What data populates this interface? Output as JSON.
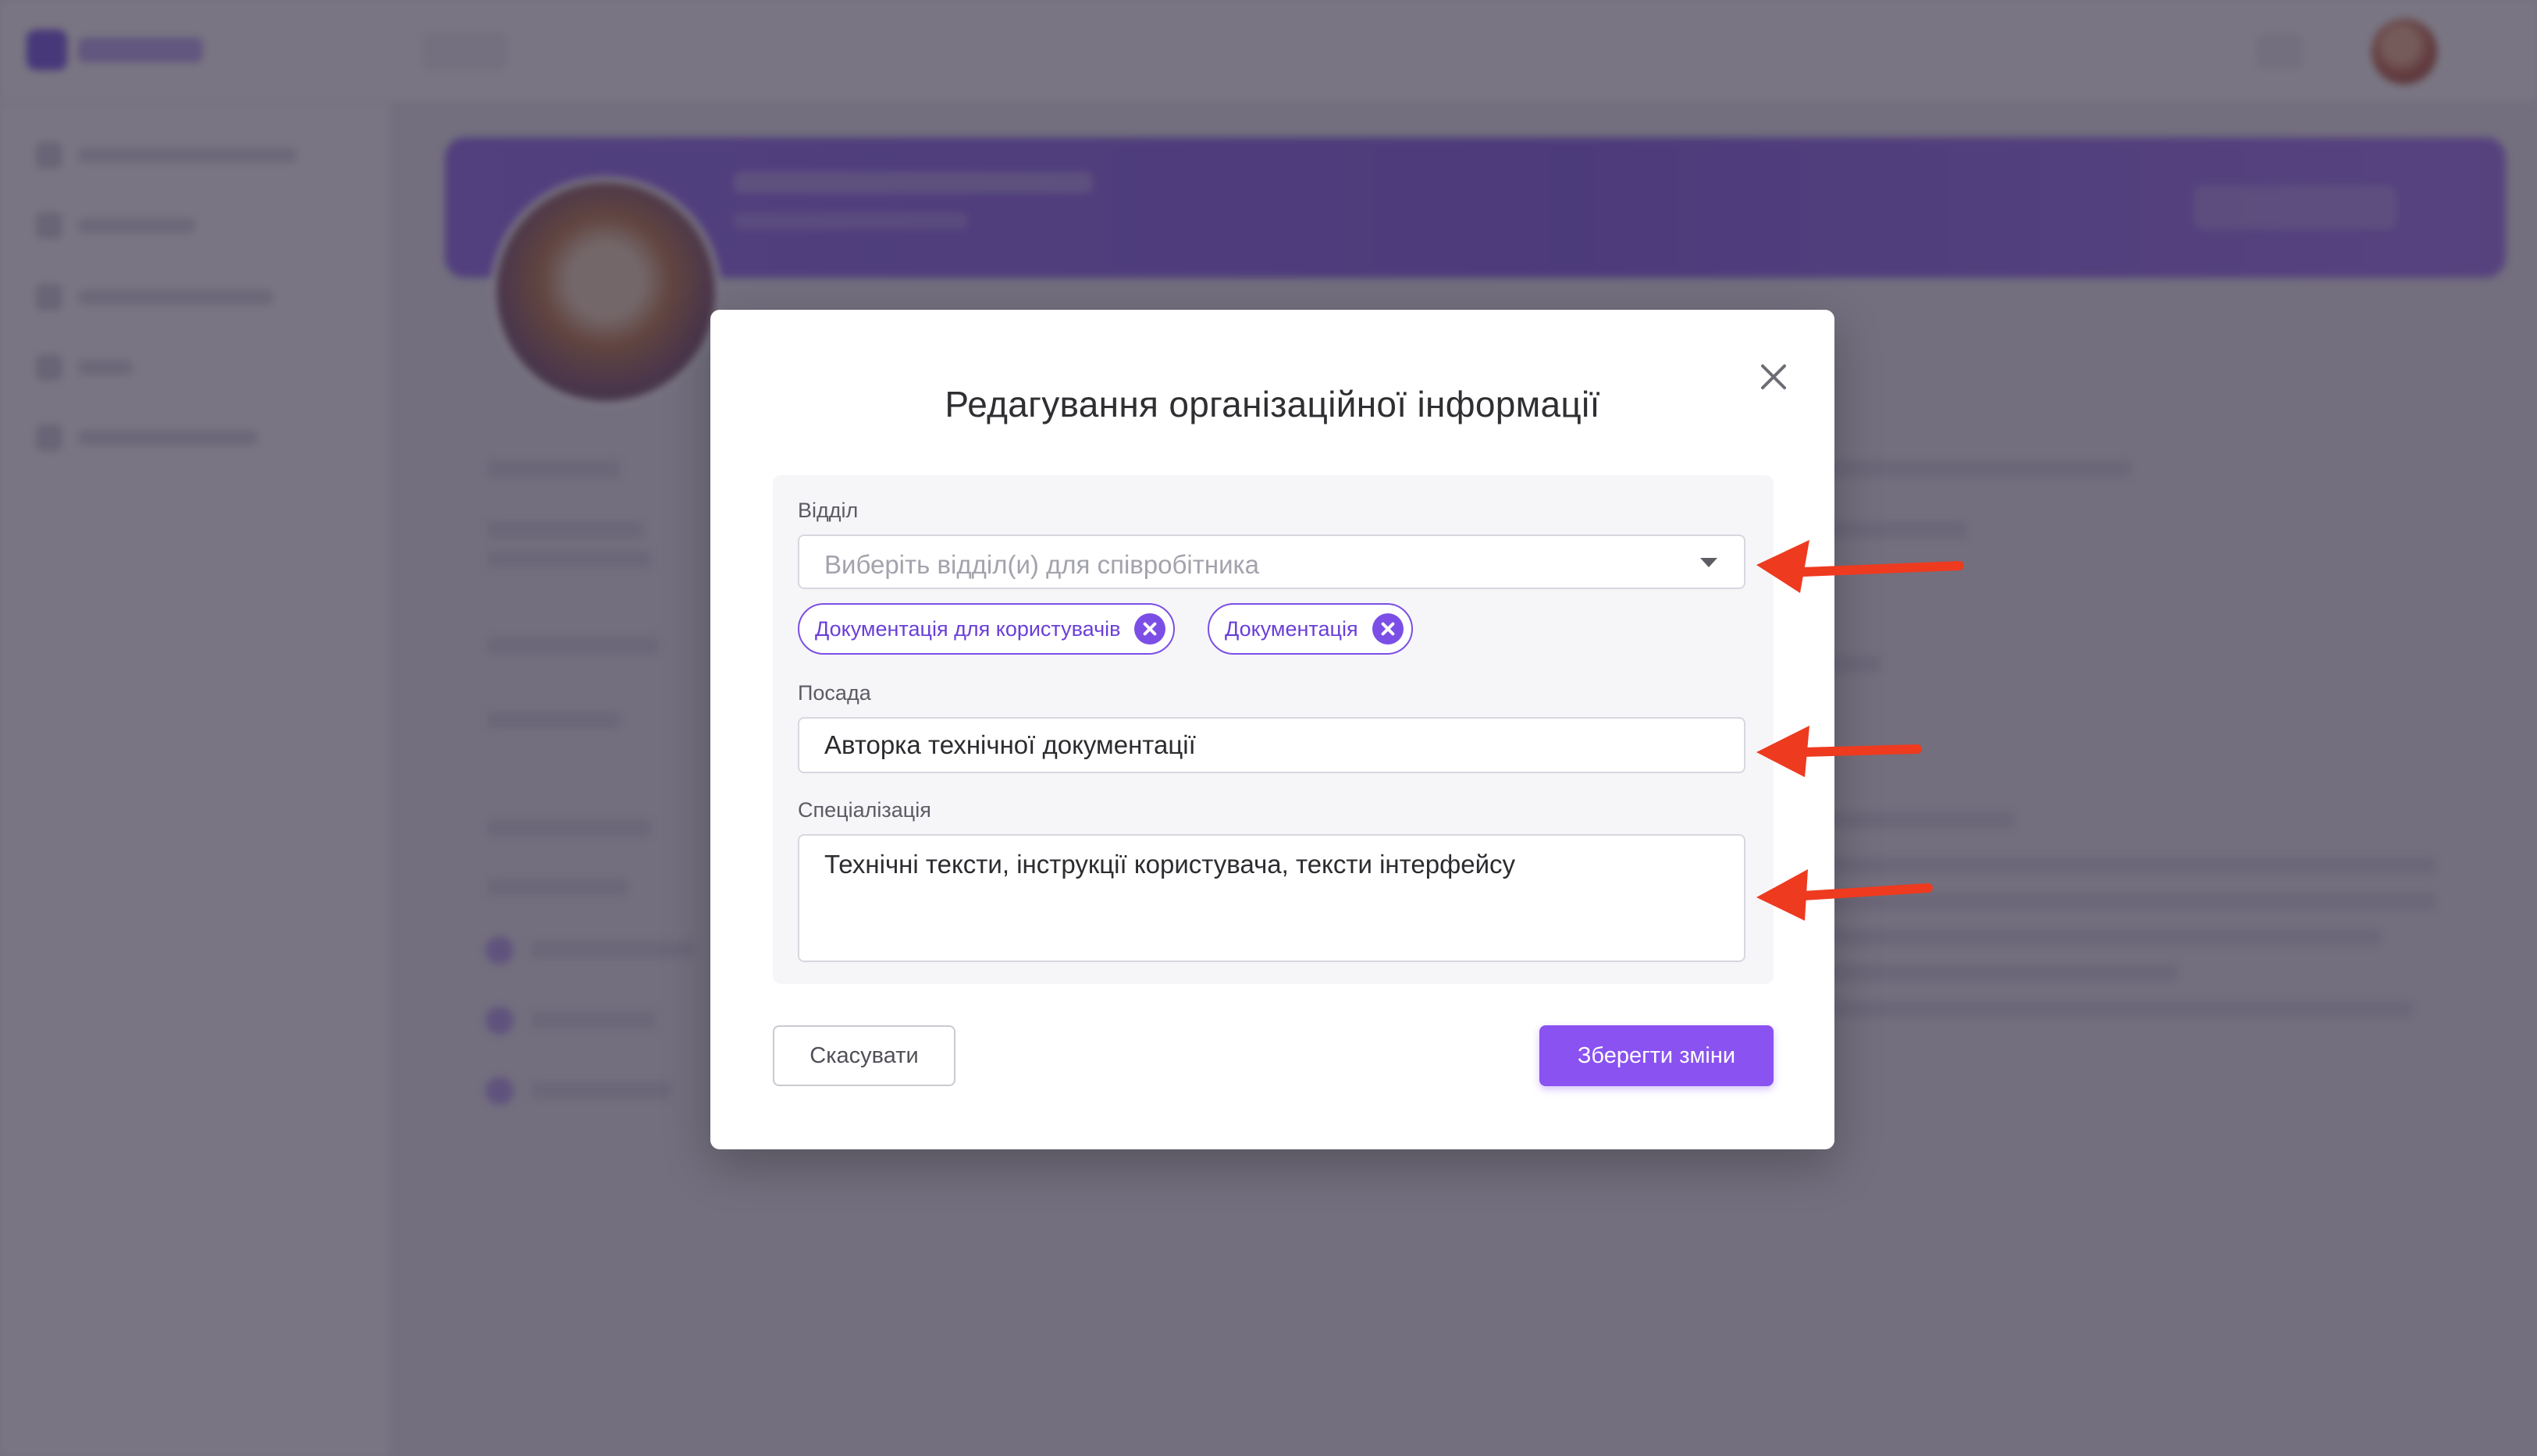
{
  "modal": {
    "title": "Редагування організаційної інформації",
    "department": {
      "label": "Відділ",
      "placeholder": "Виберіть відділ(и) для співробітника",
      "selected": [
        "Документація для користувачів",
        "Документація"
      ]
    },
    "position": {
      "label": "Посада",
      "value": "Авторка технічної документації"
    },
    "specialization": {
      "label": "Спеціалізація",
      "value": "Технічні тексти, інструкції користувача, тексти інтерфейсу"
    },
    "buttons": {
      "cancel": "Скасувати",
      "save": "Зберегти зміни"
    }
  },
  "icons": {
    "close": "close-icon",
    "dropdown": "chevron-down-icon",
    "chip_remove": "remove-tag-icon",
    "annotation": "arrow-left-icon"
  },
  "colors": {
    "accent": "#8a52f0",
    "chip_border": "#7b4fe6",
    "annotation_arrow": "#ee3a1f",
    "overlay": "#342e42"
  }
}
